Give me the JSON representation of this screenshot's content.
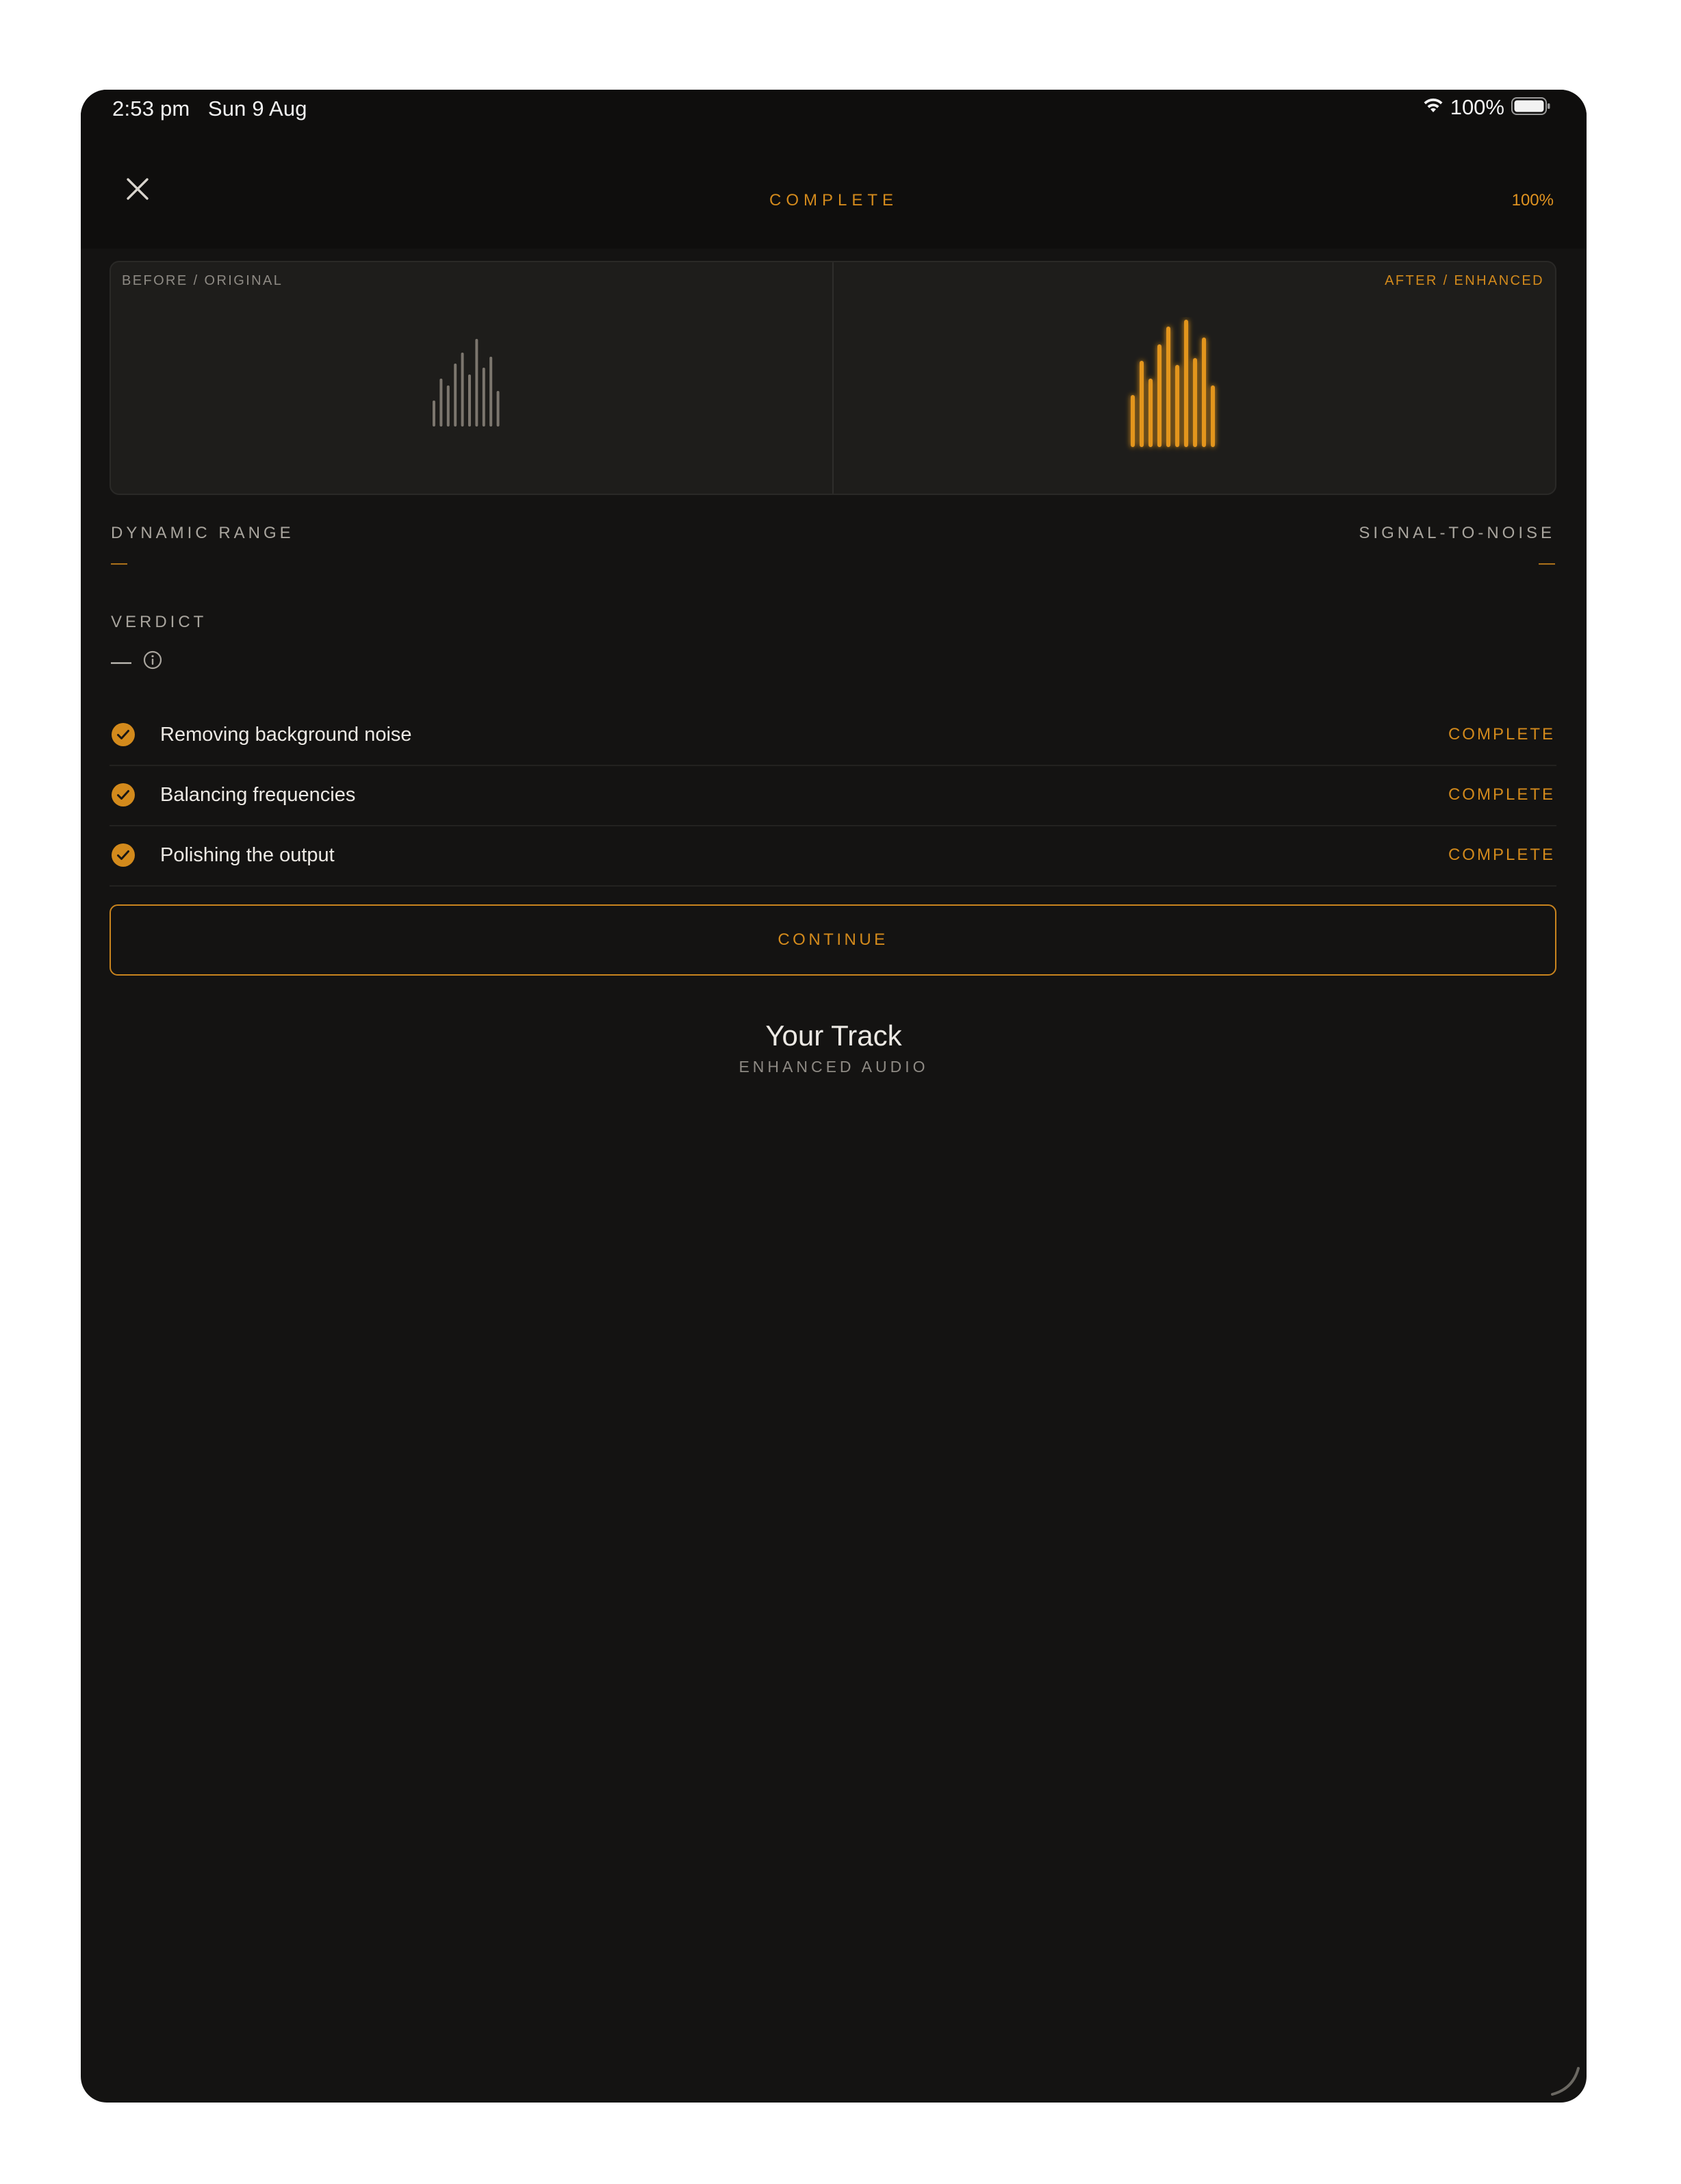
{
  "status_bar": {
    "time_date": "2:53 pm   Sun 9 Aug",
    "battery_pct": "100%",
    "icons": [
      "wifi-icon",
      "battery-icon"
    ]
  },
  "header": {
    "title": "COMPLETE",
    "progress": "100%",
    "close_icon": "close-icon"
  },
  "comparison": {
    "before_label": "BEFORE / ORIGINAL",
    "after_label": "AFTER / ENHANCED",
    "colors": {
      "before_bars": "#7c766e",
      "after_bars": "#e3951c"
    }
  },
  "metrics": {
    "dynamic_range_label": "DYNAMIC RANGE",
    "dynamic_range_value": "—",
    "snr_label": "SIGNAL-TO-NOISE",
    "snr_value": "—",
    "verdict_label": "VERDICT",
    "verdict_value": "—",
    "verdict_icon": "info-icon"
  },
  "steps": [
    {
      "label": "Removing background noise",
      "status": "COMPLETE",
      "icon": "check-circle-icon"
    },
    {
      "label": "Balancing frequencies",
      "status": "COMPLETE",
      "icon": "check-circle-icon"
    },
    {
      "label": "Polishing the output",
      "status": "COMPLETE",
      "icon": "check-circle-icon"
    }
  ],
  "continue_label": "CONTINUE",
  "track": {
    "title": "Your Track",
    "subtitle": "ENHANCED AUDIO"
  },
  "theme": {
    "accent": "#d38a1c",
    "background": "#141312"
  }
}
